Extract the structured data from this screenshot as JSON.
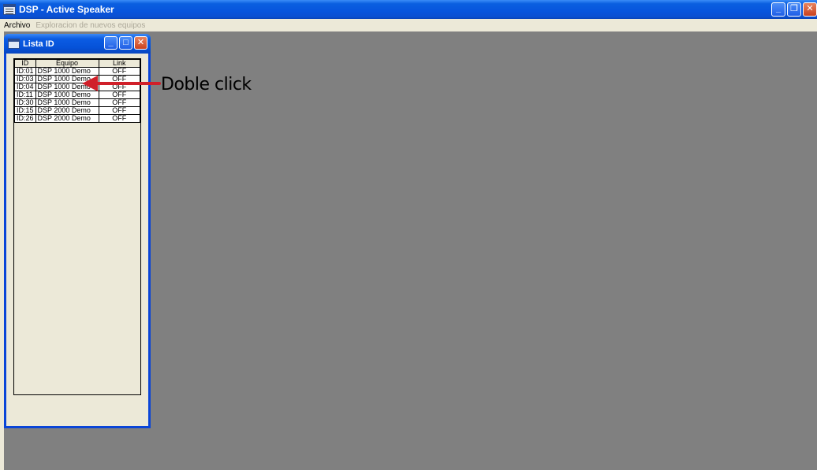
{
  "window": {
    "title": "DSP - Active Speaker",
    "controls": {
      "minimize": "_",
      "restore": "❐",
      "close": "✕"
    }
  },
  "menu": {
    "items": [
      {
        "label": "Archivo",
        "enabled": true
      },
      {
        "label": "Exploracion de nuevos equipos",
        "enabled": false
      }
    ]
  },
  "child_window": {
    "title": "Lista ID",
    "controls": {
      "minimize": "_",
      "maximize": "□",
      "close": "✕"
    },
    "table": {
      "columns": [
        "ID",
        "Equipo",
        "Link"
      ],
      "rows": [
        [
          "ID:01",
          "DSP 1000 Demo",
          "OFF"
        ],
        [
          "ID:03",
          "DSP 1000 Demo",
          "OFF"
        ],
        [
          "ID:04",
          "DSP 1000 Demo",
          "OFF"
        ],
        [
          "ID:11",
          "DSP 1000 Demo",
          "OFF"
        ],
        [
          "ID:30",
          "DSP 1000 Demo",
          "OFF"
        ],
        [
          "ID:15",
          "DSP 2000 Demo",
          "OFF"
        ],
        [
          "ID:26",
          "DSP 2000 Demo",
          "OFF"
        ]
      ]
    }
  },
  "annotation": {
    "text": "Doble click",
    "arrow_color": "#d0202a",
    "icon": "arrow-left-icon"
  },
  "colors": {
    "titlebar": "#0855dd",
    "workspace": "#808080",
    "chrome": "#ece9d8"
  }
}
